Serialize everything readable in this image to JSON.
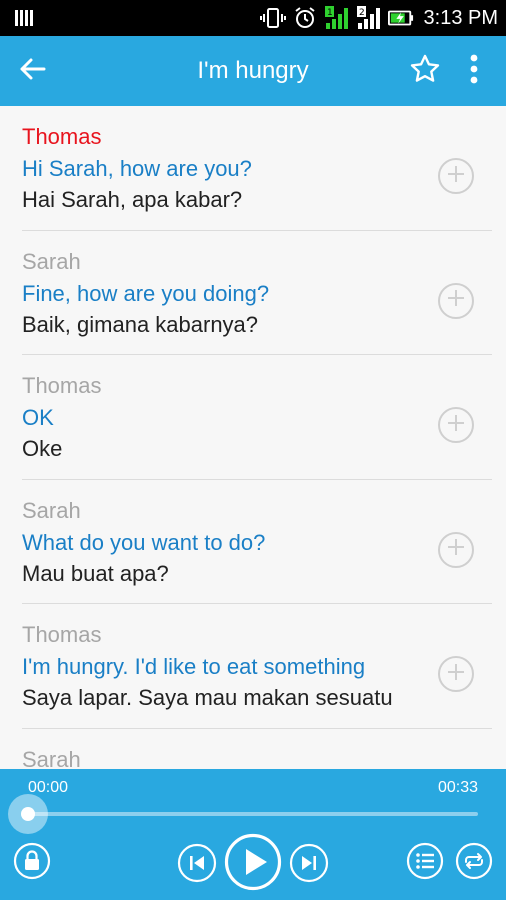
{
  "status_bar": {
    "time": "3:13 PM",
    "icons": [
      "sim-icon",
      "vibrate-icon",
      "alarm-icon",
      "signal-sim1-icon",
      "signal-sim2-icon",
      "battery-charging-icon"
    ]
  },
  "app_bar": {
    "title": "I'm hungry",
    "icons": [
      "back-arrow-icon",
      "star-icon",
      "overflow-menu-icon"
    ]
  },
  "dialogue": [
    {
      "speaker": "Thomas",
      "english": "Hi Sarah, how are you?",
      "indonesian": "Hai Sarah, apa kabar?",
      "active": true
    },
    {
      "speaker": "Sarah",
      "english": "Fine, how are you doing?",
      "indonesian": "Baik, gimana kabarnya?",
      "active": false
    },
    {
      "speaker": "Thomas",
      "english": "OK",
      "indonesian": "Oke",
      "active": false
    },
    {
      "speaker": "Sarah",
      "english": "What do you want to do?",
      "indonesian": "Mau buat apa?",
      "active": false
    },
    {
      "speaker": "Thomas",
      "english": "I'm hungry. I'd like to eat something",
      "indonesian": "Saya lapar. Saya mau makan sesuatu",
      "active": false
    },
    {
      "speaker": "Sarah",
      "english": "",
      "indonesian": "",
      "active": false
    }
  ],
  "player": {
    "current_time": "00:00",
    "total_time": "00:33",
    "progress": 0,
    "icons": [
      "lock-icon",
      "previous-icon",
      "play-icon",
      "next-icon",
      "playlist-icon",
      "repeat-icon"
    ]
  },
  "colors": {
    "accent": "#29a8e0",
    "english_text": "#1a7fc6",
    "active_speaker": "#e8141e",
    "inactive_speaker": "#a6a6a6"
  }
}
